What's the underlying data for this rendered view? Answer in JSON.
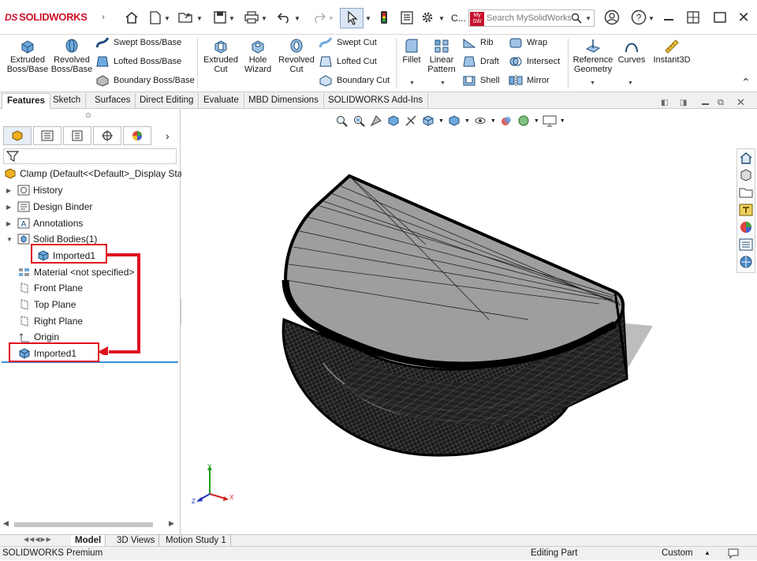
{
  "app": {
    "brand": "SOLIDWORKS",
    "brand_mark": "DS"
  },
  "topbar": {
    "search_placeholder": "Search MySolidWorks",
    "search_badge": "My SW",
    "overflow_label": "C..."
  },
  "command_manager": {
    "extruded_boss": "Extruded Boss/Base",
    "revolved_boss": "Revolved Boss/Base",
    "swept_boss": "Swept Boss/Base",
    "lofted_boss": "Lofted Boss/Base",
    "boundary_boss": "Boundary Boss/Base",
    "extruded_cut": "Extruded Cut",
    "hole_wizard": "Hole Wizard",
    "revolved_cut": "Revolved Cut",
    "swept_cut": "Swept Cut",
    "lofted_cut": "Lofted Cut",
    "boundary_cut": "Boundary Cut",
    "fillet": "Fillet",
    "linear_pattern": "Linear Pattern",
    "rib": "Rib",
    "draft": "Draft",
    "shell": "Shell",
    "wrap": "Wrap",
    "intersect": "Intersect",
    "mirror": "Mirror",
    "reference_geometry": "Reference Geometry",
    "curves": "Curves",
    "instant3d": "Instant3D"
  },
  "tabs": [
    "Features",
    "Sketch",
    "Surfaces",
    "Direct Editing",
    "Evaluate",
    "MBD Dimensions",
    "SOLIDWORKS Add-Ins"
  ],
  "tree": {
    "root": "Clamp  (Default<<Default>_Display State",
    "history": "History",
    "design_binder": "Design Binder",
    "annotations": "Annotations",
    "solid_bodies": "Solid Bodies(1)",
    "imported_body": "Imported1",
    "material": "Material <not specified>",
    "front_plane": "Front Plane",
    "top_plane": "Top Plane",
    "right_plane": "Right Plane",
    "origin": "Origin",
    "imported_feature": "Imported1"
  },
  "bottom_tabs": [
    "Model",
    "3D Views",
    "Motion Study 1"
  ],
  "status": {
    "product": "SOLIDWORKS Premium",
    "mode": "Editing Part",
    "units": "Custom"
  },
  "triad": {
    "x": "X",
    "y": "Y",
    "z": "Z"
  },
  "colors": {
    "highlight": "#e01020",
    "brand": "#d0102a"
  }
}
